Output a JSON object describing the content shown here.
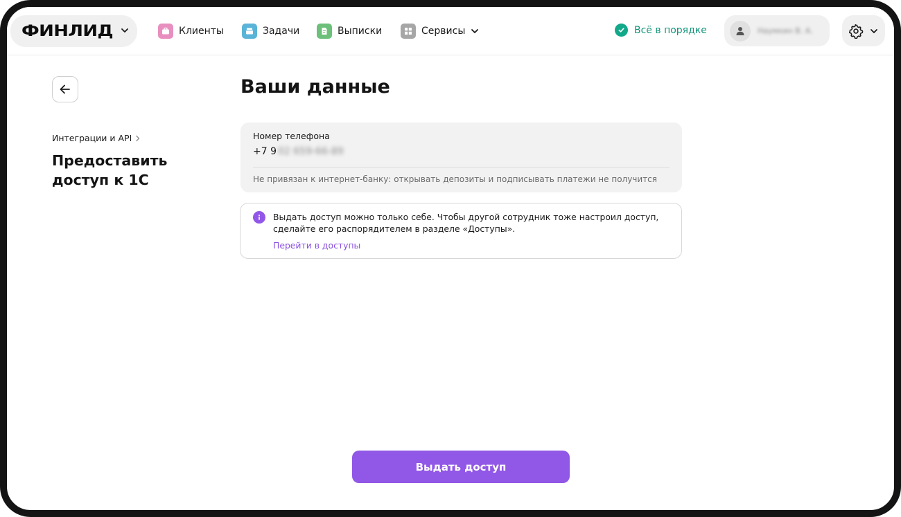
{
  "header": {
    "logo": "ФИНЛИД",
    "nav": [
      {
        "label": "Клиенты",
        "icon": "briefcase-icon",
        "color": "#e88fbf"
      },
      {
        "label": "Задачи",
        "icon": "stack-icon",
        "color": "#5ab4d8"
      },
      {
        "label": "Выписки",
        "icon": "document-icon",
        "color": "#6cc07a"
      },
      {
        "label": "Сервисы",
        "icon": "grid-icon",
        "color": "#a6a6a6"
      }
    ],
    "status": "Всё в порядке",
    "user_name": "Наумкин В. А."
  },
  "sidebar": {
    "breadcrumb": "Интеграции и API",
    "title": "Предоставить доступ к 1С"
  },
  "main": {
    "title": "Ваши данные",
    "phone": {
      "label": "Номер телефона",
      "prefix": "+7 9",
      "masked": "02 659-66-89",
      "note": "Не привязан к интернет-банку: открывать депозиты и подписывать платежи не получится"
    },
    "info": {
      "text": "Выдать доступ можно только себе. Чтобы другой сотрудник тоже настроил доступ, сделайте его распорядителем в разделе «Доступы».",
      "link": "Перейти в доступы"
    },
    "primary_button": "Выдать доступ"
  },
  "colors": {
    "accent": "#9157e6",
    "status": "#12957a"
  }
}
